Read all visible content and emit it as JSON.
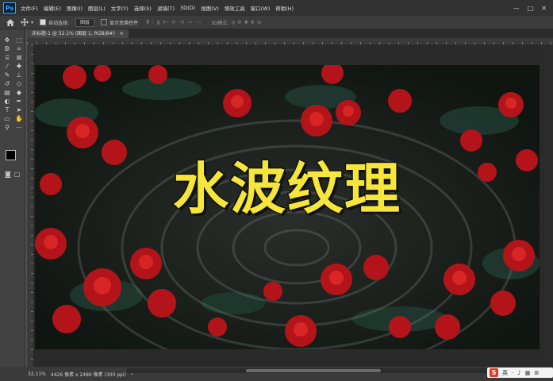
{
  "menubar": {
    "logo": "Ps",
    "items": [
      "文件(F)",
      "编辑(E)",
      "图像(I)",
      "图层(L)",
      "文字(Y)",
      "选择(S)",
      "滤镜(T)",
      "3D(D)",
      "视图(V)",
      "增效工具",
      "窗口(W)",
      "帮助(H)"
    ],
    "window_controls": [
      "—",
      "□",
      "✕"
    ]
  },
  "options": {
    "auto_select_label": "自动选择:",
    "auto_select_value": "图层",
    "transform_label": "显示变换控件",
    "mode_label": "3D模式:"
  },
  "document": {
    "tab_title": "未标题-1 @ 32.1% (图层 1, RGB/8#)",
    "tab_close": "×"
  },
  "canvas": {
    "title_text": "水波纹理",
    "title_color": "#f6e53b"
  },
  "status": {
    "zoom": "32.11%",
    "doc_info": "4426 像素 x 2489 像素 (300 ppi)"
  },
  "ime": {
    "logo": "S",
    "items": [
      "英",
      "·",
      "♪",
      "▦",
      "⊞"
    ]
  }
}
